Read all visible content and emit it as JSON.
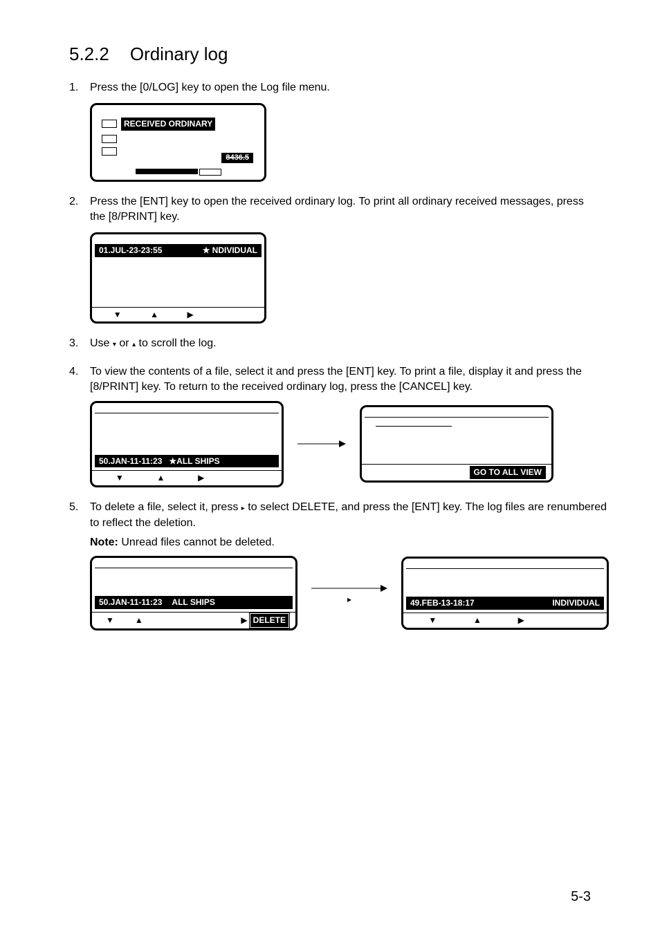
{
  "heading": {
    "number": "5.2.2",
    "title": "Ordinary log"
  },
  "steps": [
    {
      "num": "1.",
      "text": "Press the [0/LOG] key to open the Log file menu."
    },
    {
      "num": "2.",
      "text": "Press the [ENT] key to open the received ordinary log. To print all ordinary received messages, press the [8/PRINT] key."
    },
    {
      "num": "3.",
      "pre": "Use ",
      "mid": " or ",
      "post": " to scroll the log."
    },
    {
      "num": "4.",
      "text": "To view the contents of a file, select it and press the [ENT] key. To print a file, display it and press the [8/PRINT] key. To return to the received ordinary log, press the [CANCEL] key."
    },
    {
      "num": "5.",
      "pre": "To delete a file, select it, press  ",
      "post": "  to select DELETE, and press the [ENT] key. The log files are renumbered to reflect the deletion."
    }
  ],
  "note": {
    "label": "Note:",
    "text": " Unread files cannot be deleted."
  },
  "fig1": {
    "label": "RECEIVED ORDINARY",
    "value": "8436.5"
  },
  "fig2": {
    "row1_time": "01.JUL-23-23:55",
    "row1_type": "★ NDIVIDUAL",
    "nav_down": "▼",
    "nav_up": "▲",
    "nav_right": "▶"
  },
  "fig3a": {
    "row_time": "50.JAN-11-11:23",
    "row_type": "★ALL SHIPS",
    "nav_down": "▼",
    "nav_up": "▲",
    "nav_right": "▶"
  },
  "fig3b": {
    "button": "GO TO ALL VIEW"
  },
  "fig4a": {
    "row_time": "50.JAN-11-11:23",
    "row_type": "ALL SHIPS",
    "nav_down": "▼",
    "nav_up": "▲",
    "nav_right": "▶",
    "delete": "DELETE"
  },
  "fig4b": {
    "row_time": "49.FEB-13-18:17",
    "row_type": "INDIVIDUAL",
    "nav_down": "▼",
    "nav_up": "▲",
    "nav_right": "▶"
  },
  "page": "5-3",
  "glyphs": {
    "small_down": "▾",
    "small_up": "▴",
    "small_right": "▸"
  }
}
